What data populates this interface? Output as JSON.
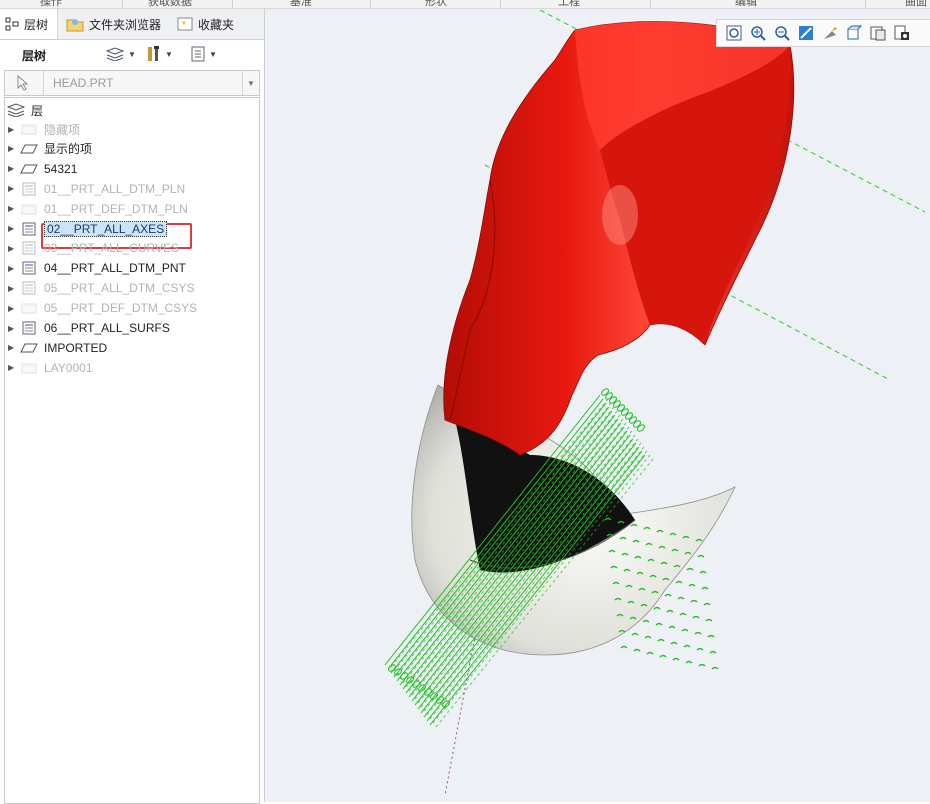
{
  "panel": {
    "tabs": [
      {
        "label": "层树",
        "icon": "layer-tree-icon"
      },
      {
        "label": "文件夹浏览器",
        "icon": "folder-browser-icon"
      },
      {
        "label": "收藏夹",
        "icon": "favorites-icon"
      }
    ],
    "toolbar_title": "层树",
    "model_name": "HEAD.PRT"
  },
  "tree": {
    "root_label": "层",
    "items": [
      {
        "label": "隐藏项",
        "state": "dim",
        "icon": "layer-folder-icon"
      },
      {
        "label": "显示的项",
        "state": "normal",
        "icon": "layer-plane-icon"
      },
      {
        "label": "54321",
        "state": "normal",
        "icon": "layer-plane-icon"
      },
      {
        "label": "01__PRT_ALL_DTM_PLN",
        "state": "dim",
        "icon": "layer-list-icon"
      },
      {
        "label": "01__PRT_DEF_DTM_PLN",
        "state": "dim",
        "icon": "layer-folder-icon"
      },
      {
        "label": "02__PRT_ALL_AXES",
        "state": "selected",
        "icon": "layer-list-icon"
      },
      {
        "label": "03__PRT_ALL_CURVES",
        "state": "dim",
        "icon": "layer-list-icon"
      },
      {
        "label": "04__PRT_ALL_DTM_PNT",
        "state": "normal",
        "icon": "layer-list-icon"
      },
      {
        "label": "05__PRT_ALL_DTM_CSYS",
        "state": "dim",
        "icon": "layer-list-icon"
      },
      {
        "label": "05__PRT_DEF_DTM_CSYS",
        "state": "dim",
        "icon": "layer-folder-icon"
      },
      {
        "label": "06__PRT_ALL_SURFS",
        "state": "normal",
        "icon": "layer-list-icon"
      },
      {
        "label": "IMPORTED",
        "state": "normal",
        "icon": "layer-plane-icon"
      },
      {
        "label": "LAY0001",
        "state": "dim",
        "icon": "layer-folder-icon"
      }
    ]
  },
  "ribbon": {
    "labels": [
      "操作",
      "获取数据",
      "基准",
      "形状",
      "工程",
      "编辑",
      "曲面"
    ]
  },
  "view_toolbar": {
    "buttons": [
      "refit-icon",
      "zoom-in-icon",
      "zoom-out-icon",
      "repaint-icon",
      "display-style-icon",
      "saved-views-icon",
      "view-manager-icon",
      "perspective-icon"
    ]
  },
  "colors": {
    "head_red": "#e8190f",
    "chin_white": "#e6e6e0",
    "curve_green": "#1fbf1f",
    "selection_red": "#e23a3a"
  }
}
